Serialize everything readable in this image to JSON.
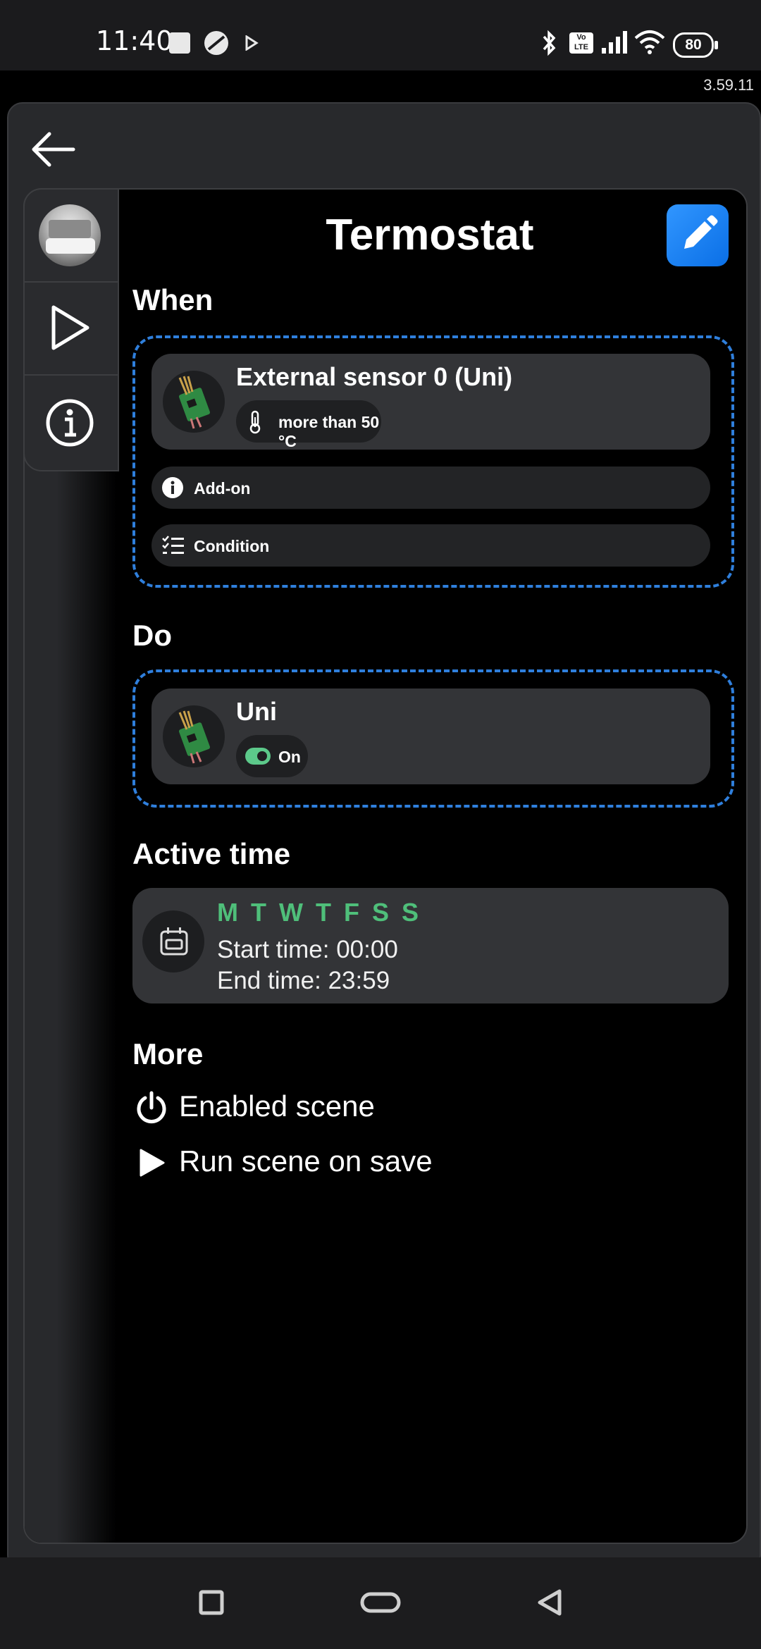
{
  "status_bar": {
    "time": "11:40",
    "battery": "80",
    "icons": [
      "square-notification-icon",
      "round-app-icon",
      "play-store-icon",
      "bluetooth-icon",
      "volte-icon",
      "signal-icon",
      "wifi-icon",
      "battery-icon"
    ]
  },
  "app": {
    "version": "3.59.11"
  },
  "scene": {
    "title": "Termostat"
  },
  "sections": {
    "when": "When",
    "do": "Do",
    "active_time": "Active time",
    "more": "More"
  },
  "when": {
    "device_name": "External sensor 0 (Uni)",
    "condition_chip": "more than 50 °C",
    "addon_label": "Add-on",
    "condition_label": "Condition"
  },
  "do": {
    "device_name": "Uni",
    "state_chip": "On"
  },
  "active_time": {
    "days": "M T W T F S S",
    "start": "Start time: 00:00",
    "end": "End time: 23:59"
  },
  "more": {
    "enabled": "Enabled scene",
    "run_on_save": "Run scene on save"
  },
  "colors": {
    "accent_blue": "#2f7fdc",
    "edit_button": "#1a7ff0",
    "day_green": "#4fbf7a",
    "toggle_green": "#5cc98a"
  }
}
